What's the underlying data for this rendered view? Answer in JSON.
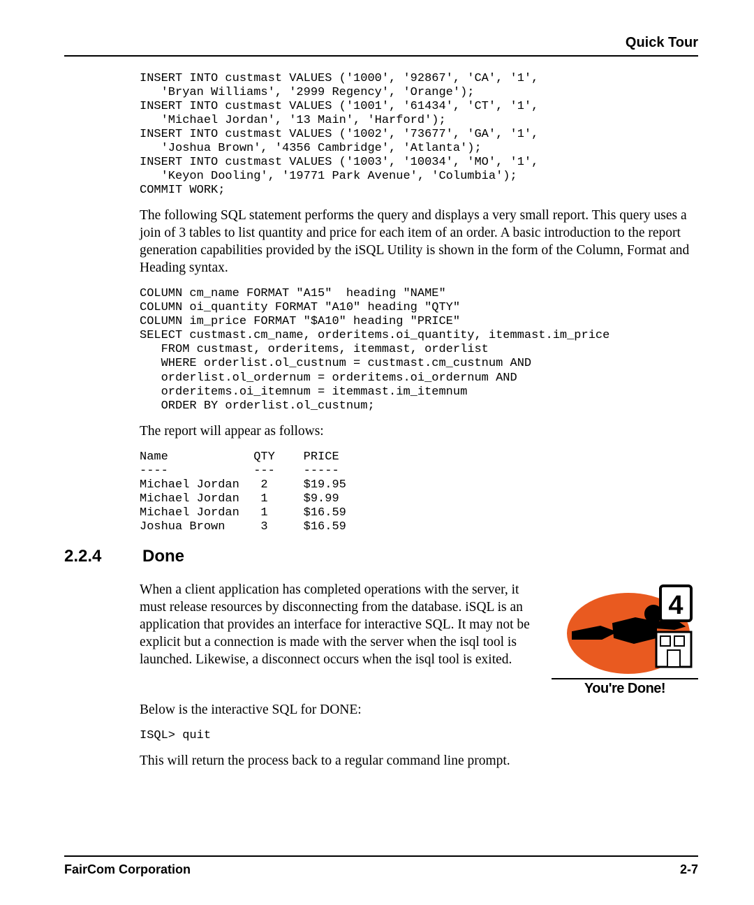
{
  "header": {
    "title": "Quick Tour"
  },
  "code1": "INSERT INTO custmast VALUES ('1000', '92867', 'CA', '1',\n   'Bryan Williams', '2999 Regency', 'Orange');\nINSERT INTO custmast VALUES ('1001', '61434', 'CT', '1',\n   'Michael Jordan', '13 Main', 'Harford');\nINSERT INTO custmast VALUES ('1002', '73677', 'GA', '1',\n   'Joshua Brown', '4356 Cambridge', 'Atlanta');\nINSERT INTO custmast VALUES ('1003', '10034', 'MO', '1',\n   'Keyon Dooling', '19771 Park Avenue', 'Columbia');\nCOMMIT WORK;",
  "para1": "The following SQL statement performs the query and displays a very small report.  This query uses a join of 3 tables to list quantity and price for each item of an order.  A basic introduction to the report generation capabilities provided by the iSQL Utility is shown in the form of the Column, Format and Heading syntax.",
  "code2": "COLUMN cm_name FORMAT \"A15\"  heading \"NAME\"\nCOLUMN oi_quantity FORMAT \"A10\" heading \"QTY\"\nCOLUMN im_price FORMAT \"$A10\" heading \"PRICE\"\nSELECT custmast.cm_name, orderitems.oi_quantity, itemmast.im_price\n   FROM custmast, orderitems, itemmast, orderlist\n   WHERE orderlist.ol_custnum = custmast.cm_custnum AND\n   orderlist.ol_ordernum = orderitems.oi_ordernum AND\n   orderitems.oi_itemnum = itemmast.im_itemnum\n   ORDER BY orderlist.ol_custnum;",
  "para2": "The report will appear as follows:",
  "code3": "Name            QTY    PRICE\n----            ---    -----\nMichael Jordan   2     $19.95\nMichael Jordan   1     $9.99\nMichael Jordan   1     $16.59\nJoshua Brown     3     $16.59",
  "section": {
    "num": "2.2.4",
    "title": "Done"
  },
  "para3": "When a client application has completed operations with the server, it must release resources by disconnecting from the database.   iSQL is an application that provides an interface for interactive SQL.  It may not be explicit but a connection is made with the server when the isql tool is launched.  Likewise, a disconnect occurs when the isql tool is exited.",
  "para4": "Below is the interactive SQL for DONE:",
  "code4": "ISQL> quit",
  "para5": "This will return the process back to a regular command line prompt.",
  "figure": {
    "caption": "You're Done!",
    "badge": "4"
  },
  "footer": {
    "company": "FairCom Corporation",
    "page": "2-7"
  }
}
